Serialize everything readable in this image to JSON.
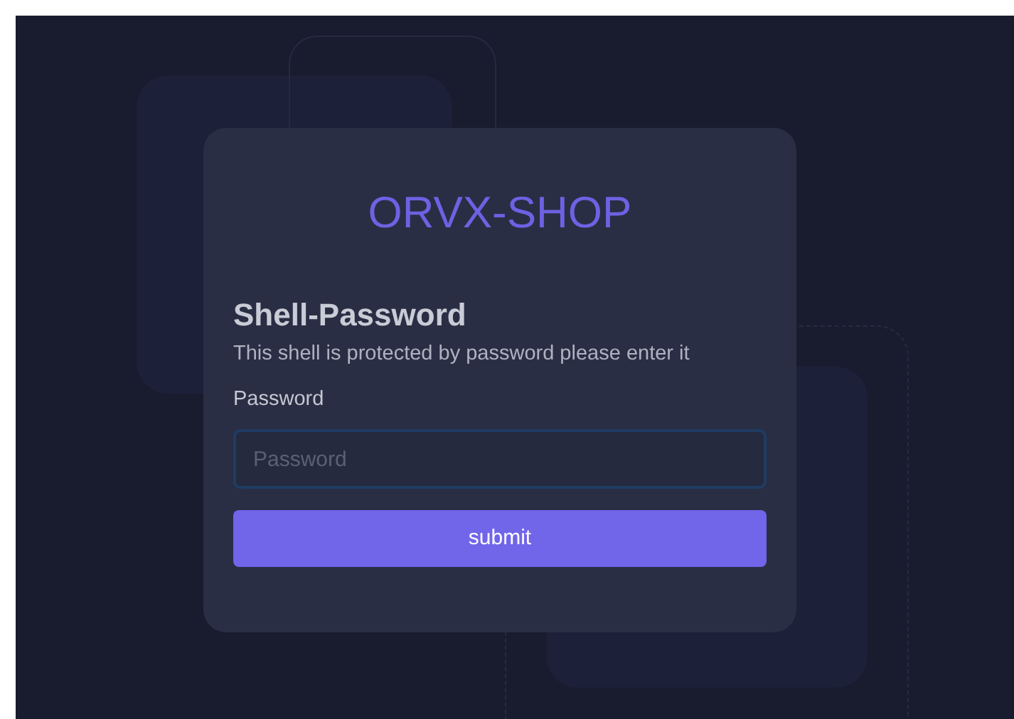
{
  "brand": "ORVX-SHOP",
  "heading": "Shell-Password",
  "description": "This shell is protected by password please enter it",
  "password_field": {
    "label": "Password",
    "placeholder": "Password",
    "focused": true
  },
  "submit_button": "submit"
}
